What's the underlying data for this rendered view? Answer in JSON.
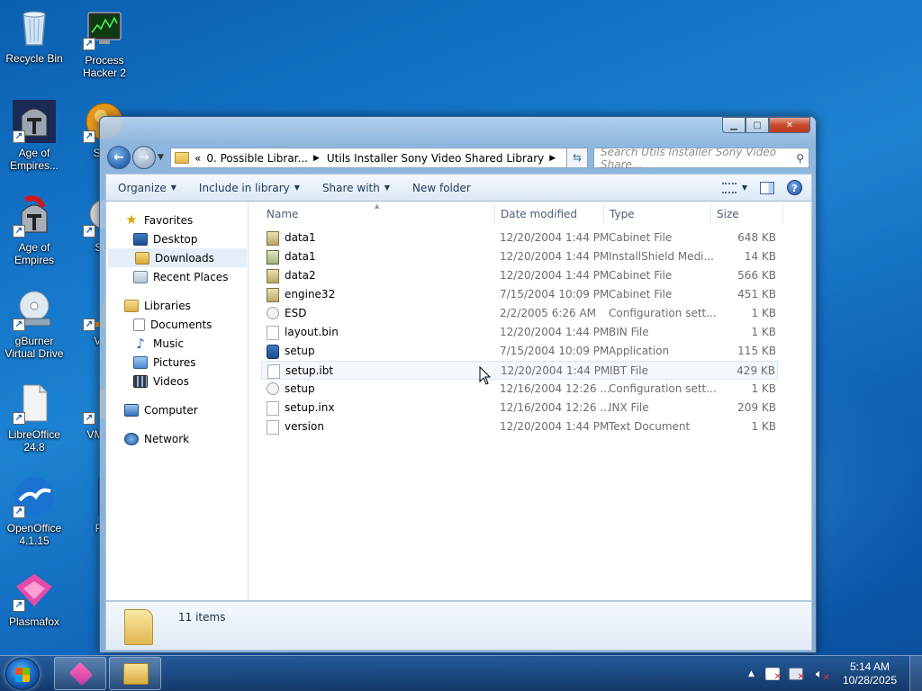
{
  "desktop": {
    "icons": [
      {
        "label": "Recycle Bin"
      },
      {
        "label": "Process Hacker 2"
      },
      {
        "label": "Age of Empires..."
      },
      {
        "label": "Serif"
      },
      {
        "label": "Age of Empires"
      },
      {
        "label": "Sup"
      },
      {
        "label": "gBurner Virtual Drive"
      },
      {
        "label": "VLC"
      },
      {
        "label": "LibreOffice 24.8"
      },
      {
        "label": "VM Wo"
      },
      {
        "label": "OpenOffice 4.1.15"
      },
      {
        "label": "Phc"
      },
      {
        "label": "Plasmafox"
      }
    ]
  },
  "window": {
    "address": {
      "prefix": "«",
      "segments": [
        "0. Possible Librar...",
        "Utils Installer Sony Video Shared Library"
      ]
    },
    "search_placeholder": "Search Utils Installer Sony Video Share...",
    "toolbar": {
      "organize": "Organize",
      "include": "Include in library",
      "share": "Share with",
      "new_folder": "New folder"
    },
    "nav": {
      "favorites": "Favorites",
      "desktop": "Desktop",
      "downloads": "Downloads",
      "recent": "Recent Places",
      "libraries": "Libraries",
      "documents": "Documents",
      "music": "Music",
      "pictures": "Pictures",
      "videos": "Videos",
      "computer": "Computer",
      "network": "Network"
    },
    "columns": {
      "name": "Name",
      "date": "Date modified",
      "type": "Type",
      "size": "Size"
    },
    "files": [
      {
        "name": "data1",
        "date": "12/20/2004 1:44 PM",
        "type": "Cabinet File",
        "size": "648 KB",
        "icon": "cabinet-file-icon"
      },
      {
        "name": "data1",
        "date": "12/20/2004 1:44 PM",
        "type": "InstallShield Medi...",
        "size": "14 KB",
        "icon": "installshield-file-icon"
      },
      {
        "name": "data2",
        "date": "12/20/2004 1:44 PM",
        "type": "Cabinet File",
        "size": "566 KB",
        "icon": "cabinet-file-icon"
      },
      {
        "name": "engine32",
        "date": "7/15/2004 10:09 PM",
        "type": "Cabinet File",
        "size": "451 KB",
        "icon": "cabinet-file-icon"
      },
      {
        "name": "ESD",
        "date": "2/2/2005 6:26 AM",
        "type": "Configuration sett...",
        "size": "1 KB",
        "icon": "config-file-icon"
      },
      {
        "name": "layout.bin",
        "date": "12/20/2004 1:44 PM",
        "type": "BIN File",
        "size": "1 KB",
        "icon": "blank-file-icon"
      },
      {
        "name": "setup",
        "date": "7/15/2004 10:09 PM",
        "type": "Application",
        "size": "115 KB",
        "icon": "application-icon"
      },
      {
        "name": "setup.ibt",
        "date": "12/20/2004 1:44 PM",
        "type": "IBT File",
        "size": "429 KB",
        "icon": "blank-file-icon"
      },
      {
        "name": "setup",
        "date": "12/16/2004 12:26 ...",
        "type": "Configuration sett...",
        "size": "1 KB",
        "icon": "config-file-icon"
      },
      {
        "name": "setup.inx",
        "date": "12/16/2004 12:26 ...",
        "type": "INX File",
        "size": "209 KB",
        "icon": "blank-file-icon"
      },
      {
        "name": "version",
        "date": "12/20/2004 1:44 PM",
        "type": "Text Document",
        "size": "1 KB",
        "icon": "blank-file-icon"
      }
    ],
    "status": "11 items"
  },
  "taskbar": {
    "time": "5:14 AM",
    "date": "10/28/2025"
  }
}
